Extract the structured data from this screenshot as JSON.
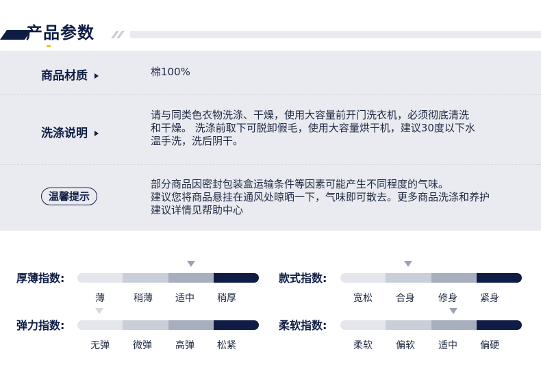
{
  "header": {
    "title": "产品参数"
  },
  "params": [
    {
      "label": "商品材质",
      "value": "棉100%"
    },
    {
      "label": "洗涤说明",
      "value_lines": [
        "请与同类色衣物洗涤、干燥，使用大容量前开门洗衣机，必须彻底清洗",
        "和干燥。 洗涤前取下可脱卸假毛，使用大容量烘干机，建议30度以下水",
        "温手洗，洗后阴干。"
      ]
    },
    {
      "label": "温馨提示",
      "value_lines": [
        "部分商品因密封包装盒运输条件等因素可能产生不同程度的气味。",
        "建议您将商品悬挂在通风处晾晒一下，气味即可散去。更多商品洗涤和养护",
        "建议详情见帮助中心"
      ]
    }
  ],
  "indices": [
    {
      "label": "厚薄指数:",
      "options": [
        "薄",
        "稍薄",
        "适中",
        "稍厚"
      ],
      "selected_index": 2
    },
    {
      "label": "款式指数:",
      "options": [
        "宽松",
        "合身",
        "修身",
        "紧身"
      ],
      "selected_index": 1
    },
    {
      "label": "弹力指数:",
      "options": [
        "无弹",
        "微弹",
        "高弹",
        "松紧"
      ],
      "selected_index": 0
    },
    {
      "label": "柔软指数:",
      "options": [
        "柔软",
        "偏软",
        "适中",
        "偏硬"
      ],
      "selected_index": 2
    }
  ],
  "colors": {
    "navy": "#0f1d45",
    "panel": "#e9ebf0"
  }
}
